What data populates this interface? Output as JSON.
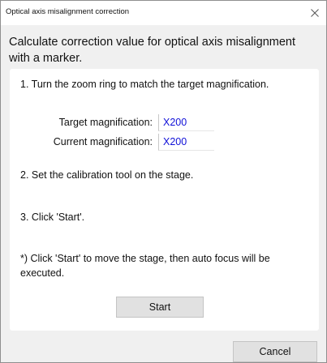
{
  "window": {
    "title": "Optical axis misalignment correction",
    "close_icon": "close-icon"
  },
  "intro": "Calculate correction value for optical axis misalignment with a marker.",
  "panel": {
    "step1": "1. Turn the zoom ring to match the target magnification.",
    "target_label": "Target magnification:",
    "target_value": "X200",
    "current_label": "Current magnification:",
    "current_value": "X200",
    "step2": "2. Set the calibration tool on the stage.",
    "step3": "3. Click 'Start'.",
    "note": "*) Click 'Start' to move the stage, then auto focus will be executed.",
    "start_label": "Start"
  },
  "footer": {
    "cancel_label": "Cancel"
  },
  "colors": {
    "magnification_value": "#1010d8",
    "dialog_background": "#f0f0f0",
    "panel_background": "#ffffff",
    "button_background": "#e1e1e1"
  }
}
